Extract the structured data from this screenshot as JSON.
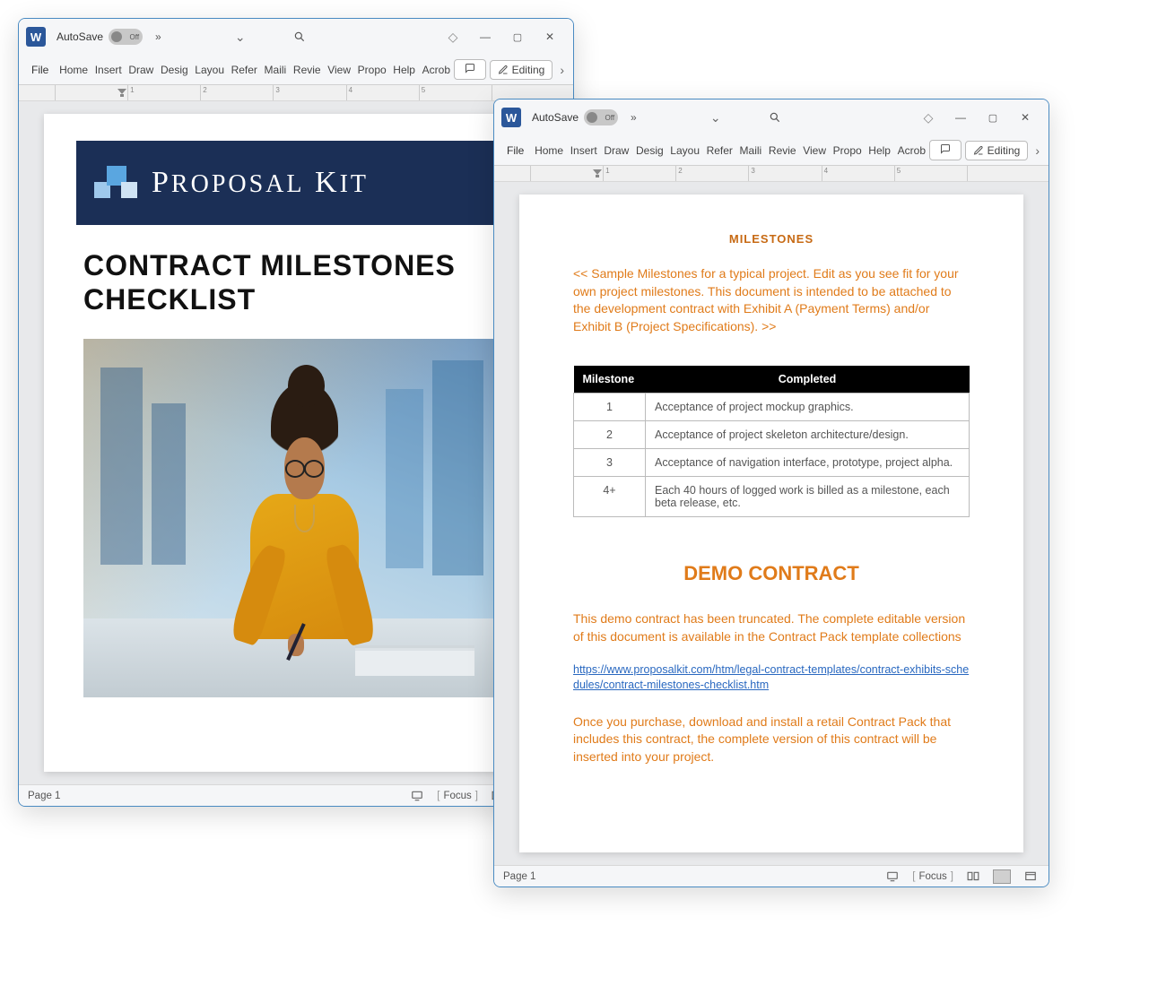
{
  "autosave_label": "AutoSave",
  "autosave_state": "Off",
  "ribbon_tabs": [
    "File",
    "Home",
    "Insert",
    "Draw",
    "Design",
    "Layout",
    "References",
    "Mailings",
    "Review",
    "View",
    "Proposal",
    "Help",
    "Acrobat"
  ],
  "ribbon_tabs_short": [
    "File",
    "Home",
    "Insert",
    "Draw",
    "Desig",
    "Layou",
    "Refer",
    "Maili",
    "Revie",
    "View",
    "Propo",
    "Help",
    "Acrob"
  ],
  "editing_label": "Editing",
  "statusbar_page": "Page 1",
  "statusbar_focus": "Focus",
  "window1": {
    "banner_brand": "Proposal Kit",
    "doc_title_line1": "CONTRACT MILESTONES",
    "doc_title_line2": "CHECKLIST"
  },
  "window2": {
    "milestones_heading": "MILESTONES",
    "sample_text": "<< Sample Milestones for a typical project.  Edit as you see fit for your own project milestones.  This document is intended to be attached to the development contract with Exhibit A (Payment Terms) and/or Exhibit B (Project Specifications). >>",
    "table": {
      "header_milestone": "Milestone",
      "header_completed": "Completed",
      "rows": [
        {
          "n": "1",
          "text": "Acceptance of project mockup graphics."
        },
        {
          "n": "2",
          "text": "Acceptance of project skeleton architecture/design."
        },
        {
          "n": "3",
          "text": "Acceptance of navigation interface, prototype, project alpha."
        },
        {
          "n": "4+",
          "text": "Each 40 hours of logged work is billed as a milestone, each beta release, etc."
        }
      ]
    },
    "demo_heading": "DEMO CONTRACT",
    "demo_text": "This demo contract has been truncated. The complete editable version of this document is available in the Contract Pack template collections",
    "demo_link": "https://www.proposalkit.com/htm/legal-contract-templates/contract-exhibits-schedules/contract-milestones-checklist.htm",
    "demo_purchase": "Once you purchase, download and install a retail Contract Pack that includes this contract, the complete version of this contract will be inserted into your project."
  },
  "ruler_marks": [
    "1",
    "2",
    "3",
    "4",
    "5"
  ]
}
